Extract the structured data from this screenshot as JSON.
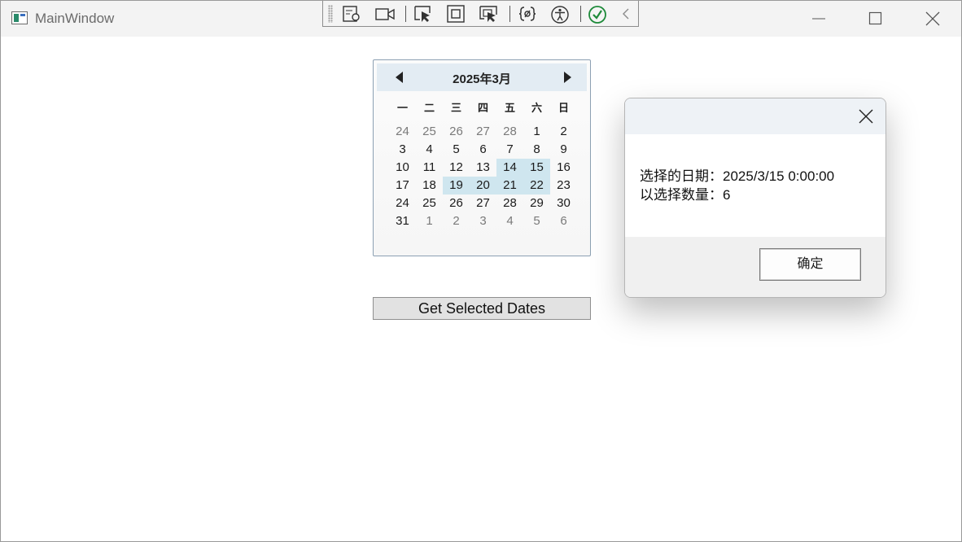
{
  "window": {
    "title": "MainWindow",
    "minimize_icon": "minimize-icon",
    "maximize_icon": "maximize-icon",
    "close_icon": "close-icon"
  },
  "devtools": {
    "icons": [
      "grip-icon",
      "visual-tree-icon",
      "video-icon",
      "select-element-icon",
      "display-layout-adorners-icon",
      "track-focus-icon",
      "binding-failures-icon",
      "accessibility-icon",
      "hot-reload-check-icon",
      "collapse-chevron-icon"
    ]
  },
  "calendar": {
    "title": "2025年3月",
    "prev_icon": "triangle-left-icon",
    "next_icon": "triangle-right-icon",
    "weekdays": [
      "一",
      "二",
      "三",
      "四",
      "五",
      "六",
      "日"
    ],
    "weeks": [
      [
        {
          "d": "24",
          "o": true
        },
        {
          "d": "25",
          "o": true
        },
        {
          "d": "26",
          "o": true
        },
        {
          "d": "27",
          "o": true
        },
        {
          "d": "28",
          "o": true
        },
        {
          "d": "1"
        },
        {
          "d": "2"
        }
      ],
      [
        {
          "d": "3"
        },
        {
          "d": "4"
        },
        {
          "d": "5"
        },
        {
          "d": "6"
        },
        {
          "d": "7"
        },
        {
          "d": "8"
        },
        {
          "d": "9"
        }
      ],
      [
        {
          "d": "10"
        },
        {
          "d": "11"
        },
        {
          "d": "12"
        },
        {
          "d": "13"
        },
        {
          "d": "14",
          "s": true
        },
        {
          "d": "15",
          "s": true
        },
        {
          "d": "16"
        }
      ],
      [
        {
          "d": "17"
        },
        {
          "d": "18"
        },
        {
          "d": "19",
          "s": true
        },
        {
          "d": "20",
          "s": true
        },
        {
          "d": "21",
          "s": true
        },
        {
          "d": "22",
          "s": true
        },
        {
          "d": "23"
        }
      ],
      [
        {
          "d": "24"
        },
        {
          "d": "25"
        },
        {
          "d": "26"
        },
        {
          "d": "27"
        },
        {
          "d": "28"
        },
        {
          "d": "29"
        },
        {
          "d": "30"
        }
      ],
      [
        {
          "d": "31"
        },
        {
          "d": "1",
          "o": true
        },
        {
          "d": "2",
          "o": true
        },
        {
          "d": "3",
          "o": true
        },
        {
          "d": "4",
          "o": true
        },
        {
          "d": "5",
          "o": true
        },
        {
          "d": "6",
          "o": true
        }
      ]
    ],
    "selected_color": "#cfe6ef"
  },
  "button": {
    "label": "Get Selected Dates"
  },
  "dialog": {
    "line1": "选择的日期：2025/3/15 0:00:00",
    "line2": "以选择数量：6",
    "ok_label": "确定",
    "close_icon": "close-icon"
  }
}
